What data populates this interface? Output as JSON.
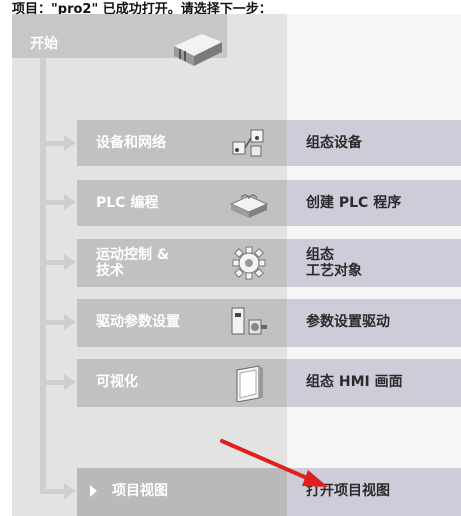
{
  "header": {
    "text": "项目：\"pro2\" 已成功打开。请选择下一步："
  },
  "start": {
    "label": "开始",
    "icon": "start-portal-icon"
  },
  "items": [
    {
      "label": "设备和网络",
      "icon": "devices-network-icon",
      "action": "组态设备"
    },
    {
      "label": "PLC 编程",
      "icon": "plc-program-icon",
      "action": "创建 PLC 程序"
    },
    {
      "label_line1": "运动控制 &",
      "label_line2": "技术",
      "icon": "motion-gear-icon",
      "action_line1": "组态",
      "action_line2": "工艺对象"
    },
    {
      "label": "驱动参数设置",
      "icon": "drive-icon",
      "action": "参数设置驱动"
    },
    {
      "label": "可视化",
      "icon": "visualization-panel-icon",
      "action": "组态 HMI 画面"
    },
    {
      "label": "项目视图",
      "icon": "chevron-right-icon",
      "action": "打开项目视图"
    }
  ],
  "colors": {
    "tile": "#c1c1c1",
    "action": "#cdcdda",
    "annotation_arrow": "#e02020"
  }
}
